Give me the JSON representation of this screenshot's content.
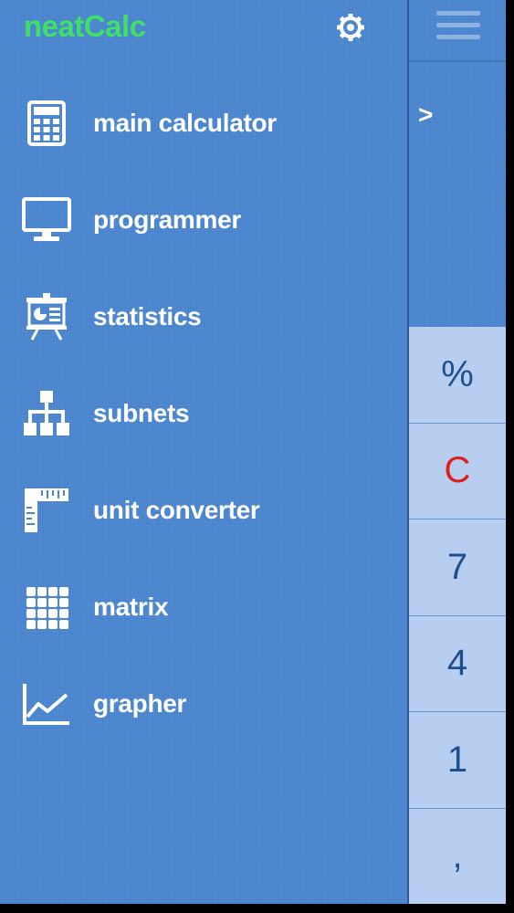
{
  "app": {
    "title": "neatCalc"
  },
  "menu": {
    "items": [
      {
        "label": "main calculator",
        "icon": "calculator-icon"
      },
      {
        "label": "programmer",
        "icon": "monitor-icon"
      },
      {
        "label": "statistics",
        "icon": "presentation-board-icon"
      },
      {
        "label": "subnets",
        "icon": "network-tree-icon"
      },
      {
        "label": "unit converter",
        "icon": "ruler-icon"
      },
      {
        "label": "matrix",
        "icon": "grid-icon"
      },
      {
        "label": "grapher",
        "icon": "line-graph-icon"
      }
    ]
  },
  "calculator": {
    "chevron": ">",
    "keys": [
      {
        "label": "%",
        "color": "#1e4f8e"
      },
      {
        "label": "C",
        "color": "#e01e1e"
      },
      {
        "label": "7",
        "color": "#1e4f8e"
      },
      {
        "label": "4",
        "color": "#1e4f8e"
      },
      {
        "label": "1",
        "color": "#1e4f8e"
      },
      {
        "label": ",",
        "color": "#1e4f8e"
      }
    ]
  },
  "colors": {
    "background": "#4a86cf",
    "title": "#3fe06a",
    "key": "#b7cef0"
  }
}
